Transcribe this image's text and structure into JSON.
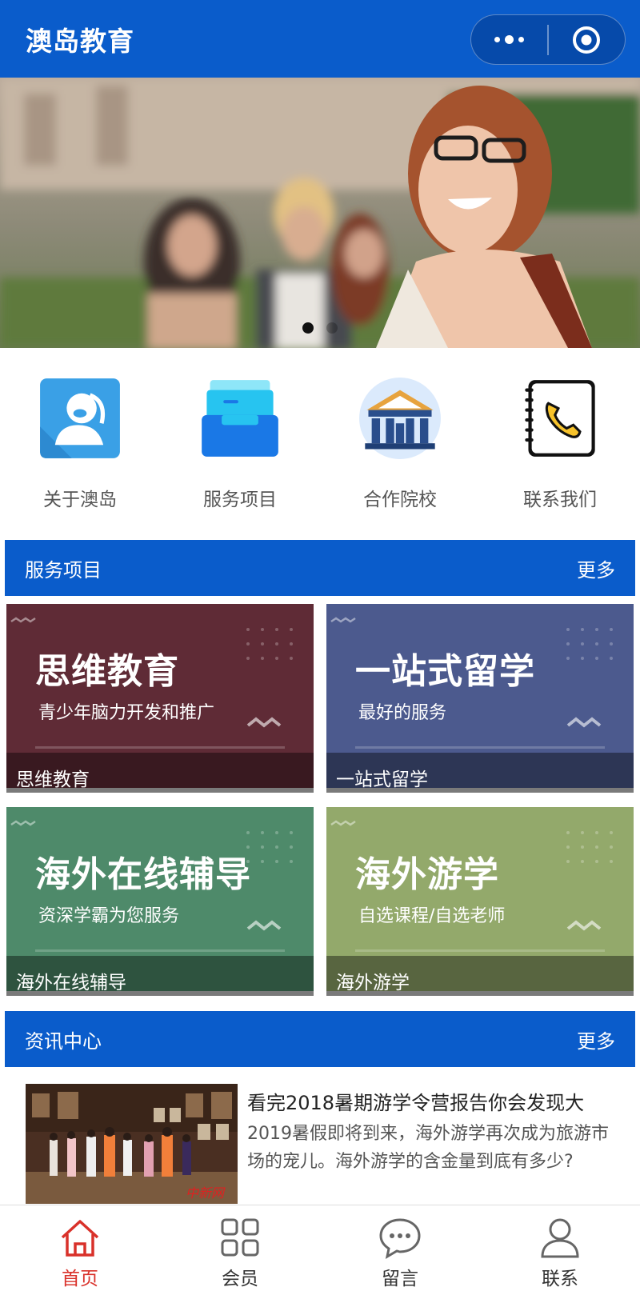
{
  "header": {
    "title": "澳岛教育"
  },
  "banner": {
    "slides": 2,
    "active_slide": 1
  },
  "quick_links": [
    {
      "label": "关于澳岛",
      "icon": "about-icon"
    },
    {
      "label": "服务项目",
      "icon": "services-icon"
    },
    {
      "label": "合作院校",
      "icon": "school-building-icon"
    },
    {
      "label": "联系我们",
      "icon": "phone-book-icon"
    }
  ],
  "services": {
    "title": "服务项目",
    "more": "更多",
    "cards": [
      {
        "heading": "思维教育",
        "subtitle": "青少年脑力开发和推广",
        "caption": "思维教育",
        "color": "#5f2b36"
      },
      {
        "heading": "一站式留学",
        "subtitle": "最好的服务",
        "caption": "一站式留学",
        "color": "#4c5a8e"
      },
      {
        "heading": "海外在线辅导",
        "subtitle": "资深学霸为您服务",
        "caption": "海外在线辅导",
        "color": "#4e8a6a"
      },
      {
        "heading": "海外游学",
        "subtitle": "自选课程/自选老师",
        "caption": "海外游学",
        "color": "#93a96b"
      }
    ]
  },
  "news_center": {
    "title": "资讯中心",
    "more": "更多",
    "items": [
      {
        "title": "看完2018暑期游学令营报告你会发现大",
        "desc": "2019暑假即将到来，海外游学再次成为旅游市场的宠儿。海外游学的含金量到底有多少?",
        "image_watermark": "中新网"
      }
    ]
  },
  "tabbar": {
    "tabs": [
      {
        "label": "首页",
        "icon": "home-icon",
        "active": true
      },
      {
        "label": "会员",
        "icon": "grid-icon",
        "active": false
      },
      {
        "label": "留言",
        "icon": "chat-bubble-icon",
        "active": false
      },
      {
        "label": "联系",
        "icon": "person-icon",
        "active": false
      }
    ]
  },
  "colors": {
    "brand_blue": "#0a5ccb",
    "active_red": "#d9312a"
  }
}
